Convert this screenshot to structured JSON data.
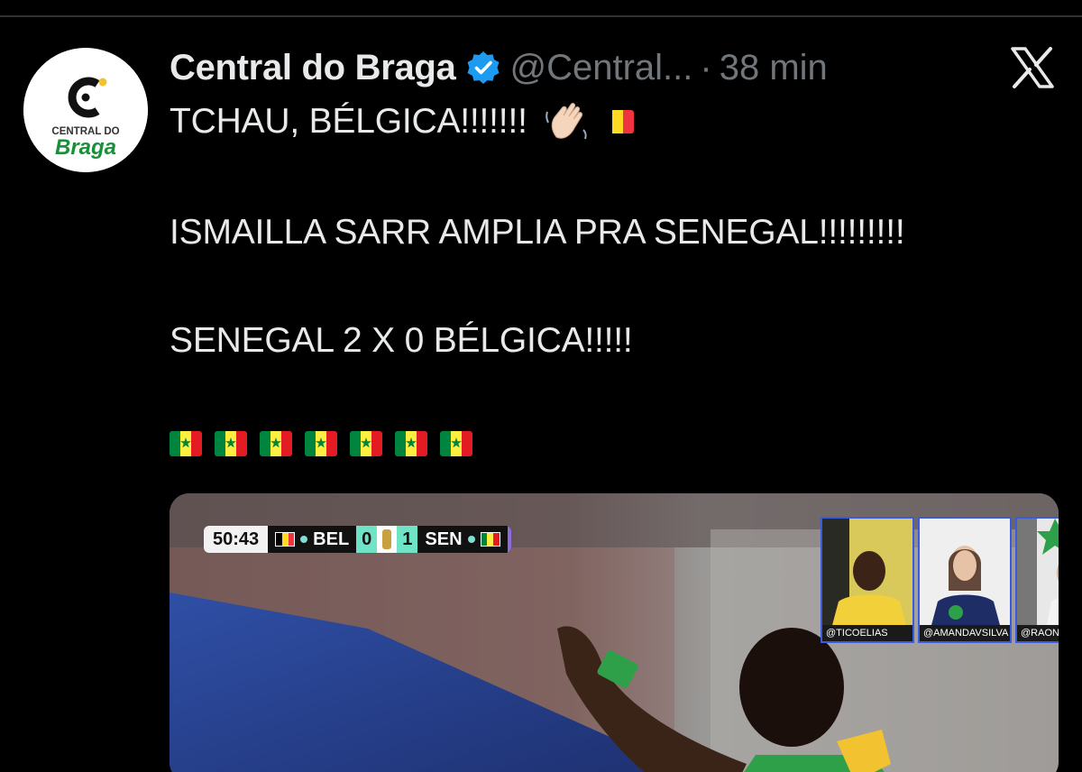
{
  "tweet": {
    "display_name": "Central do Braga",
    "handle": "@Central...",
    "separator": "·",
    "time": "38 min",
    "lines": [
      "TCHAU, BÉLGICA!!!!!!!",
      "ISMAILLA SARR AMPLIA PRA SENEGAL!!!!!!!!!",
      "SENEGAL 2 X 0 BÉLGICA!!!!!"
    ],
    "senegal_flag_count": 7
  },
  "avatar": {
    "line1": "CENTRAL DO",
    "line2": "Braga"
  },
  "media": {
    "clock": "50:43",
    "team_left": "BEL",
    "score_left": "0",
    "score_right": "1",
    "team_right": "SEN",
    "cams": [
      {
        "label": "@TICOELIAS"
      },
      {
        "label": "@AMANDAVSILVA"
      },
      {
        "label": "@RAONY_"
      }
    ]
  },
  "icons": {
    "verified": "verified-badge-icon",
    "x": "x-logo-icon",
    "wave": "waving-hand-icon"
  },
  "colors": {
    "background": "#000000",
    "text": "#e7e9ea",
    "secondary": "#71767b",
    "verified": "#1d9bf0",
    "brand_green": "#1a8f3a",
    "brand_yellow": "#f2c230"
  }
}
